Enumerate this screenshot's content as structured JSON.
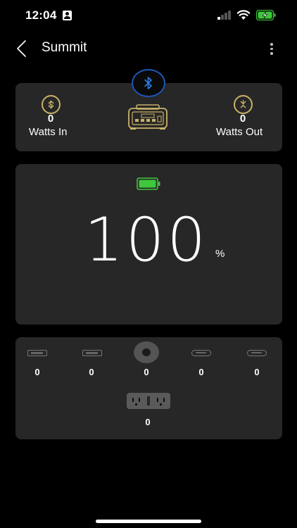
{
  "status_bar": {
    "time": "12:04"
  },
  "header": {
    "title": "Summit"
  },
  "power_flow": {
    "watts_in_value": "0",
    "watts_in_label": "Watts In",
    "watts_out_value": "0",
    "watts_out_label": "Watts Out"
  },
  "battery": {
    "percent": "100",
    "unit": "%",
    "level_fraction": 1.0
  },
  "ports": {
    "usb_a_1": "0",
    "usb_a_2": "0",
    "wireless": "0",
    "usb_c_1": "0",
    "usb_c_2": "0",
    "ac_outlet": "0"
  },
  "colors": {
    "background": "#000000",
    "card": "#272727",
    "accent_gold": "#c9b26a",
    "bluetooth_blue": "#2f7fe0",
    "battery_green": "#3ec83b"
  },
  "icons": {
    "back": "chevron-left-icon",
    "more": "more-vertical-icon",
    "bluetooth": "bluetooth-icon",
    "watts_in": "arrow-in-icon",
    "watts_out": "arrow-out-icon",
    "device": "power-station-icon",
    "battery": "battery-icon",
    "usb_a": "usb-a-port-icon",
    "usb_c": "usb-c-port-icon",
    "wireless": "wireless-charging-icon",
    "ac": "ac-outlet-icon"
  }
}
